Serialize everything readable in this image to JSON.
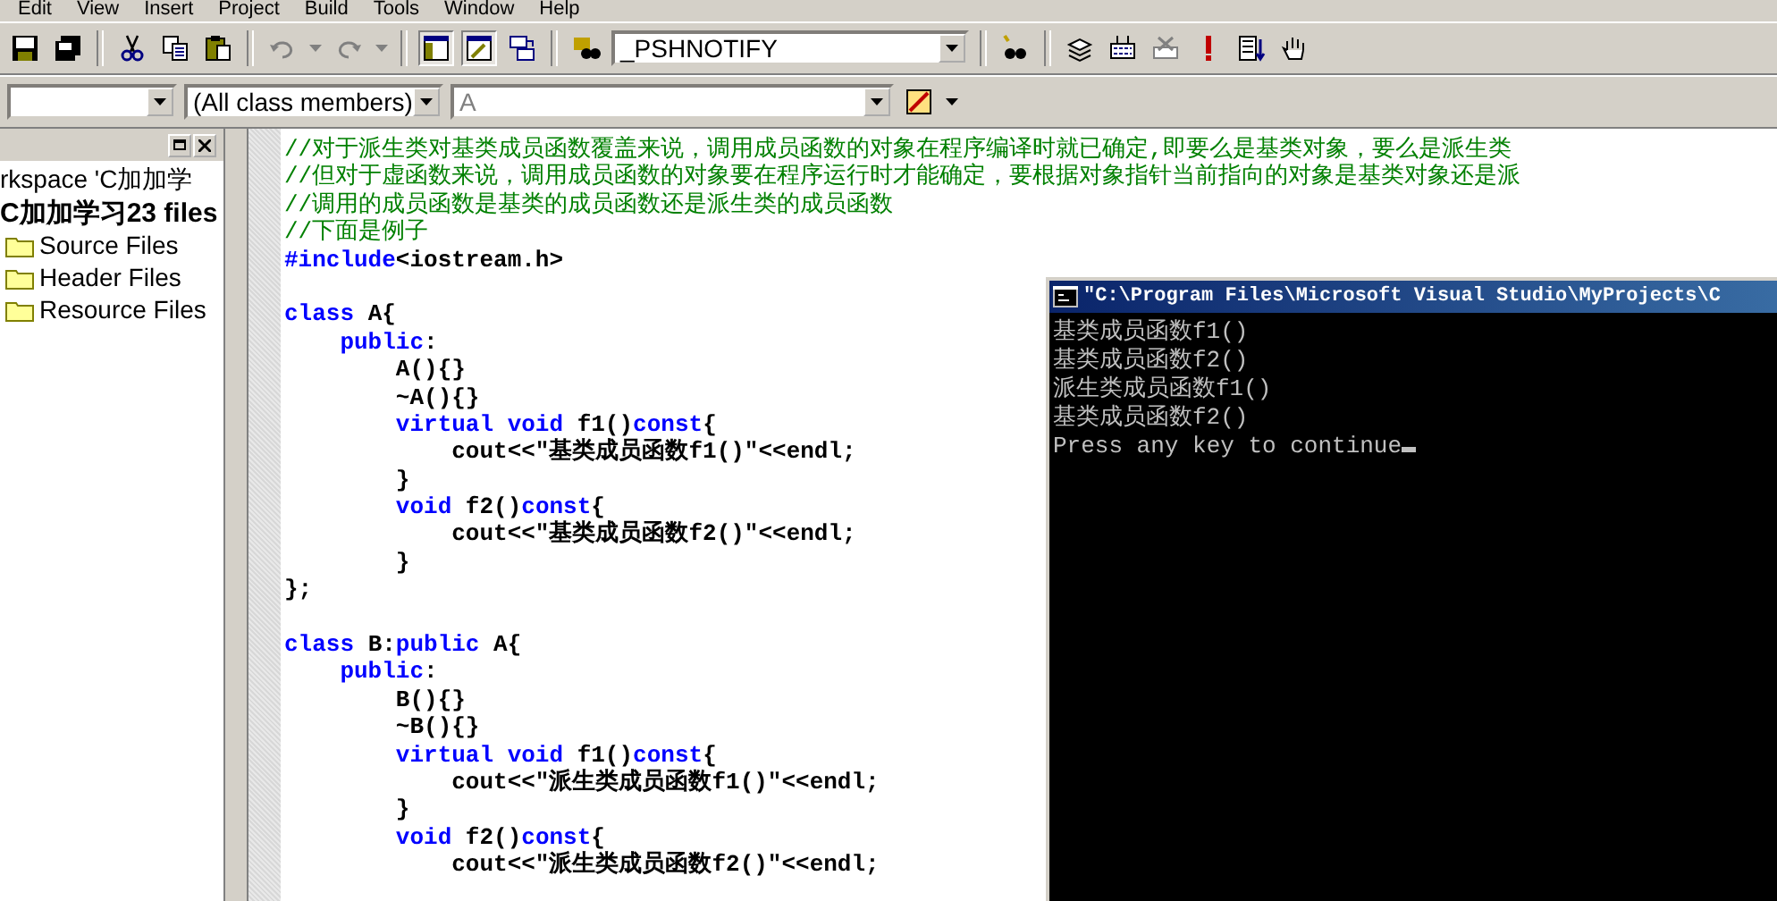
{
  "menu": [
    "Edit",
    "View",
    "Insert",
    "Project",
    "Build",
    "Tools",
    "Window",
    "Help"
  ],
  "toolbar": {
    "find_combo": {
      "value": "_PSHNOTIFY"
    }
  },
  "wizard_bar": {
    "members_filter": {
      "value": "(All class members)"
    },
    "member": {
      "value": "A",
      "disabled": true
    }
  },
  "workspace": {
    "items": [
      {
        "label": "rkspace 'C加加学",
        "kind": "workspace",
        "bold": false
      },
      {
        "label": "C加加学习23 files",
        "kind": "project",
        "bold": true
      },
      {
        "label": "Source Files",
        "kind": "folder",
        "bold": false
      },
      {
        "label": "Header Files",
        "kind": "folder",
        "bold": false
      },
      {
        "label": "Resource Files",
        "kind": "folder",
        "bold": false
      }
    ]
  },
  "editor": {
    "lines": [
      {
        "kind": "code",
        "tokens": [
          {
            "kind": "comment",
            "text": "//对于派生类对基类成员函数覆盖来说，调用成员函数的对象在程序编译时就已确定,即要么是基类对象，要么是派生类"
          }
        ]
      },
      {
        "kind": "code",
        "tokens": [
          {
            "kind": "comment",
            "text": "//但对于虚函数来说，调用成员函数的对象要在程序运行时才能确定，要根据对象指针当前指向的对象是基类对象还是派"
          }
        ]
      },
      {
        "kind": "code",
        "tokens": [
          {
            "kind": "comment",
            "text": "//调用的成员函数是基类的成员函数还是派生类的成员函数"
          }
        ]
      },
      {
        "kind": "code",
        "tokens": [
          {
            "kind": "comment",
            "text": "//下面是例子"
          }
        ]
      },
      {
        "kind": "code",
        "tokens": [
          {
            "kind": "keyword",
            "text": "#include"
          },
          {
            "kind": "plain",
            "text": "<iostream.h>"
          }
        ]
      },
      {
        "kind": "blank"
      },
      {
        "kind": "code",
        "tokens": [
          {
            "kind": "keyword",
            "text": "class"
          },
          {
            "kind": "plain",
            "text": " A{"
          }
        ]
      },
      {
        "kind": "code",
        "tokens": [
          {
            "kind": "keyword",
            "text": "    public"
          },
          {
            "kind": "plain",
            "text": ":"
          }
        ]
      },
      {
        "kind": "code",
        "tokens": [
          {
            "kind": "plain",
            "text": "        A(){}"
          }
        ]
      },
      {
        "kind": "code",
        "tokens": [
          {
            "kind": "plain",
            "text": "        ~A(){}"
          }
        ]
      },
      {
        "kind": "code",
        "tokens": [
          {
            "kind": "keyword",
            "text": "        virtual void"
          },
          {
            "kind": "plain",
            "text": " f1()"
          },
          {
            "kind": "keyword",
            "text": "const"
          },
          {
            "kind": "plain",
            "text": "{"
          }
        ]
      },
      {
        "kind": "code",
        "tokens": [
          {
            "kind": "plain",
            "text": "            cout<<\"基类成员函数f1()\"<<endl;"
          }
        ]
      },
      {
        "kind": "code",
        "tokens": [
          {
            "kind": "plain",
            "text": "        }"
          }
        ]
      },
      {
        "kind": "code",
        "tokens": [
          {
            "kind": "keyword",
            "text": "        void"
          },
          {
            "kind": "plain",
            "text": " f2()"
          },
          {
            "kind": "keyword",
            "text": "const"
          },
          {
            "kind": "plain",
            "text": "{"
          }
        ]
      },
      {
        "kind": "code",
        "tokens": [
          {
            "kind": "plain",
            "text": "            cout<<\"基类成员函数f2()\"<<endl;"
          }
        ]
      },
      {
        "kind": "code",
        "tokens": [
          {
            "kind": "plain",
            "text": "        }"
          }
        ]
      },
      {
        "kind": "code",
        "tokens": [
          {
            "kind": "plain",
            "text": "};"
          }
        ]
      },
      {
        "kind": "blank"
      },
      {
        "kind": "code",
        "tokens": [
          {
            "kind": "keyword",
            "text": "class"
          },
          {
            "kind": "plain",
            "text": " B:"
          },
          {
            "kind": "keyword",
            "text": "public"
          },
          {
            "kind": "plain",
            "text": " A{"
          }
        ]
      },
      {
        "kind": "code",
        "tokens": [
          {
            "kind": "keyword",
            "text": "    public"
          },
          {
            "kind": "plain",
            "text": ":"
          }
        ]
      },
      {
        "kind": "code",
        "tokens": [
          {
            "kind": "plain",
            "text": "        B(){}"
          }
        ]
      },
      {
        "kind": "code",
        "tokens": [
          {
            "kind": "plain",
            "text": "        ~B(){}"
          }
        ]
      },
      {
        "kind": "code",
        "tokens": [
          {
            "kind": "keyword",
            "text": "        virtual void"
          },
          {
            "kind": "plain",
            "text": " f1()"
          },
          {
            "kind": "keyword",
            "text": "const"
          },
          {
            "kind": "plain",
            "text": "{"
          }
        ]
      },
      {
        "kind": "code",
        "tokens": [
          {
            "kind": "plain",
            "text": "            cout<<\"派生类成员函数f1()\"<<endl;"
          }
        ]
      },
      {
        "kind": "code",
        "tokens": [
          {
            "kind": "plain",
            "text": "        }"
          }
        ]
      },
      {
        "kind": "code",
        "tokens": [
          {
            "kind": "keyword",
            "text": "        void"
          },
          {
            "kind": "plain",
            "text": " f2()"
          },
          {
            "kind": "keyword",
            "text": "const"
          },
          {
            "kind": "plain",
            "text": "{"
          }
        ]
      },
      {
        "kind": "code",
        "tokens": [
          {
            "kind": "plain",
            "text": "            cout<<\"派生类成员函数f2()\"<<endl;"
          }
        ]
      }
    ]
  },
  "console": {
    "title": "\"C:\\Program Files\\Microsoft Visual Studio\\MyProjects\\C",
    "lines": [
      "基类成员函数f1()",
      "基类成员函数f2()",
      "派生类成员函数f1()",
      "基类成员函数f2()",
      "Press any key to continue"
    ]
  }
}
